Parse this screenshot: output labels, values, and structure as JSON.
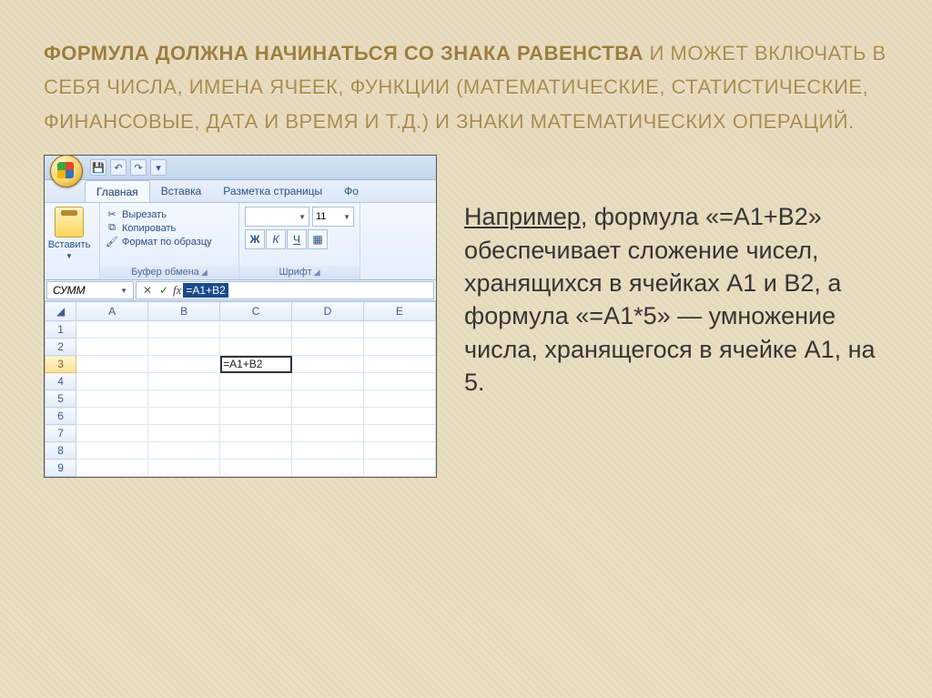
{
  "title": {
    "bold_part": "ФОРМУЛА ДОЛЖНА НАЧИНАТЬСЯ СО ЗНАКА РАВЕНСТВА",
    "rest": " И МОЖЕТ ВКЛЮЧАТЬ В СЕБЯ ЧИСЛА, ИМЕНА ЯЧЕЕК, ФУНКЦИИ (МАТЕМАТИЧЕСКИЕ, СТАТИСТИЧЕСКИЕ, ФИНАНСОВЫЕ, ДАТА И ВРЕМЯ И Т.Д.) И ЗНАКИ МАТЕМАТИЧЕСКИХ ОПЕРАЦИЙ."
  },
  "body": {
    "lead": "   Например",
    "rest": ", формула «=А1+В2» обеспечивает сложение чисел, хранящихся в ячейках А1 и В2, а формула «=А1*5» — умножение числа, хранящегося в ячейке А1, на 5."
  },
  "excel": {
    "qat": {
      "save": "💾",
      "undo": "↶",
      "redo": "↷",
      "more": "▾"
    },
    "tabs": [
      "Главная",
      "Вставка",
      "Разметка страницы",
      "Фо"
    ],
    "paste_label": "Вставить",
    "clipboard": {
      "cut": "Вырезать",
      "copy": "Копировать",
      "format": "Формат по образцу",
      "caption": "Буфер обмена"
    },
    "font": {
      "size": "11",
      "caption": "Шрифт",
      "bold": "Ж",
      "italic": "К",
      "under": "Ч"
    },
    "namebox": "СУММ",
    "fx_label": "fx",
    "formula": "=A1+B2",
    "cancel": "✕",
    "enter": "✓",
    "columns": [
      "A",
      "B",
      "C",
      "D",
      "E"
    ],
    "rows": [
      "1",
      "2",
      "3",
      "4",
      "5",
      "6",
      "7",
      "8",
      "9"
    ],
    "cell_value": "=A1+B2",
    "selection": {
      "row": 3,
      "col": "C"
    }
  }
}
